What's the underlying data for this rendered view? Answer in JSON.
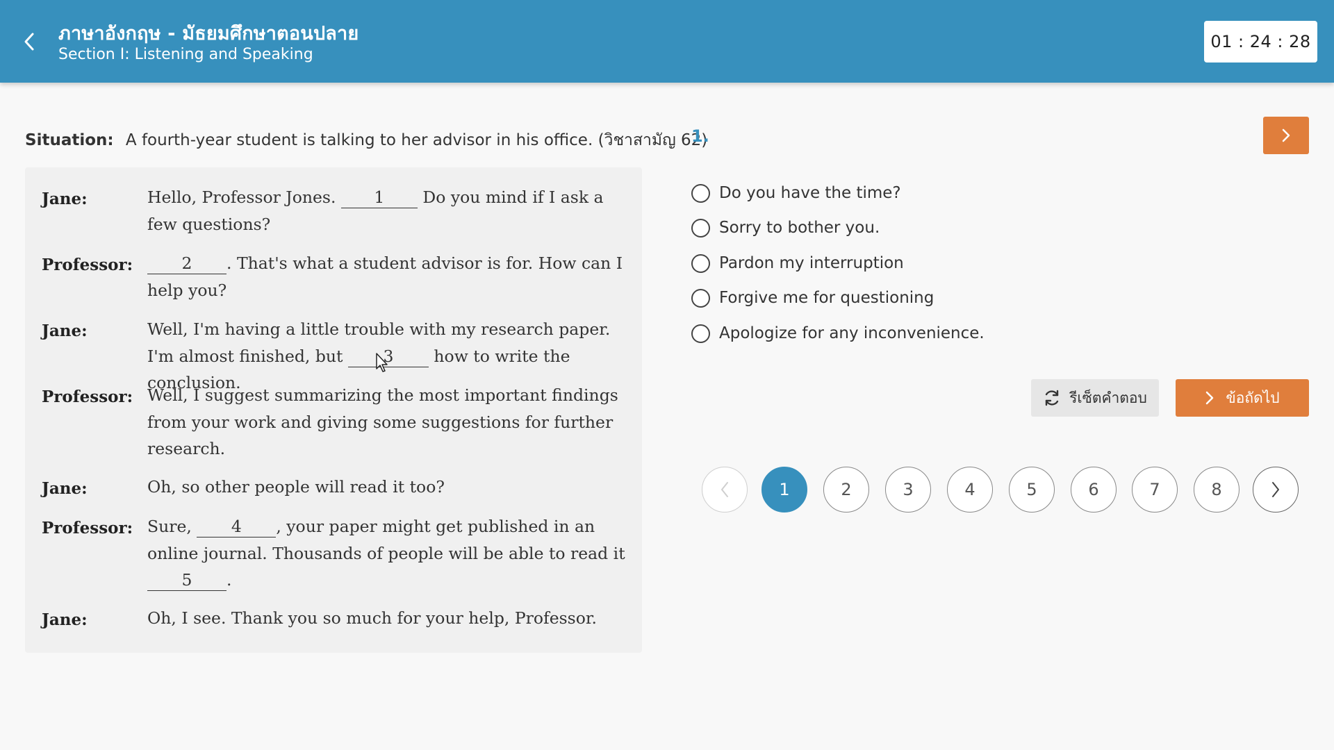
{
  "header": {
    "title": "ภาษาอังกฤษ - มัธยมศึกษาตอนปลาย",
    "subtitle": "Section I: Listening and Speaking",
    "timer": "01 : 24 : 28",
    "back_icon": "chevron-left-icon"
  },
  "situation": {
    "label": "Situation:",
    "text": "A fourth-year student is talking to her advisor in his office. (วิชาสามัญ 62)"
  },
  "dialogue": [
    {
      "speaker": "Jane:",
      "before": "Hello, Professor Jones. ",
      "blank": "1",
      "after": " Do you mind if I ask a few questions?"
    },
    {
      "speaker": "Professor:",
      "before": "",
      "blank": "2",
      "after": ". That's what a student advisor is for. How can I help you?"
    },
    {
      "speaker": "Jane:",
      "before": "Well, I'm having a little trouble with my research paper. I'm almost finished, but ",
      "blank": "3",
      "after": " how to write the conclusion."
    },
    {
      "speaker": "Professor:",
      "before": "Well, I suggest summarizing the most important findings from your work and giving some suggestions for further research.",
      "blank": "",
      "after": ""
    },
    {
      "speaker": "Jane:",
      "before": "Oh, so other people will read it too?",
      "blank": "",
      "after": ""
    },
    {
      "speaker": "Professor:",
      "before": "Sure, ",
      "blank": "4",
      "after": ", your paper might get published in an online journal. Thousands of people will be able to read it ",
      "blank2": "5",
      "after2": "."
    },
    {
      "speaker": "Jane:",
      "before": "Oh, I see. Thank you so much for your help, Professor.",
      "blank": "",
      "after": ""
    }
  ],
  "question": {
    "number": "1.",
    "options": [
      "Do you have the time?",
      "Sorry to bother you.",
      "Pardon my interruption",
      "Forgive me for questioning",
      "Apologize for any inconvenience."
    ]
  },
  "actions": {
    "reset_label": "รีเซ็ตคำตอบ",
    "reset_icon": "refresh-icon",
    "next_label": "ข้อถัดไป",
    "next_icon": "chevron-right-icon"
  },
  "pagination": {
    "pages": [
      "1",
      "2",
      "3",
      "4",
      "5",
      "6",
      "7",
      "8"
    ],
    "current": "1"
  },
  "colors": {
    "primary": "#3790bd",
    "accent": "#e07e3c"
  }
}
